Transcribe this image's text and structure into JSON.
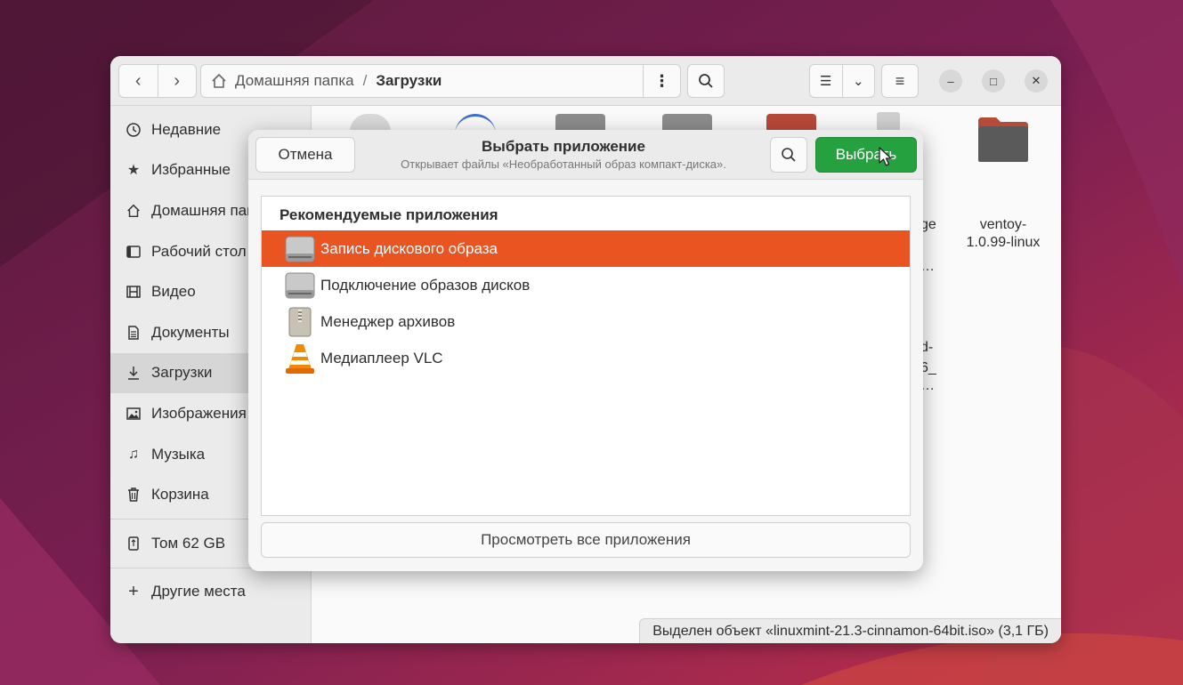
{
  "file_manager": {
    "path": {
      "home": "Домашняя папка",
      "separator": "/",
      "current": "Загрузки"
    },
    "sidebar": {
      "items": [
        {
          "label": "Недавние",
          "icon": "clock-icon"
        },
        {
          "label": "Избранные",
          "icon": "star-icon"
        },
        {
          "label": "Домашняя папка",
          "icon": "home-icon"
        },
        {
          "label": "Рабочий стол",
          "icon": "desktop-icon"
        },
        {
          "label": "Видео",
          "icon": "film-icon"
        },
        {
          "label": "Документы",
          "icon": "document-icon"
        },
        {
          "label": "Загрузки",
          "icon": "download-icon",
          "active": true
        },
        {
          "label": "Изображения",
          "icon": "image-icon"
        },
        {
          "label": "Музыка",
          "icon": "music-icon"
        },
        {
          "label": "Корзина",
          "icon": "trash-icon"
        }
      ],
      "devices": [
        {
          "label": "Том 62 GB",
          "icon": "usb-drive-icon"
        }
      ],
      "other": {
        "label": "Другие места",
        "icon": "plus-icon"
      }
    },
    "files": {
      "partial_label_1a": "ge",
      "partial_label_1b": "…",
      "partial_label_2a": "d-",
      "partial_label_2b": "6_",
      "partial_label_2c": "…",
      "folder_label_line1": "ventoy-",
      "folder_label_line2": "1.0.99-linux"
    },
    "status": "Выделен объект «linuxmint-21.3-cinnamon-64bit.iso» (3,1 ГБ)"
  },
  "dialog": {
    "cancel_label": "Отмена",
    "title": "Выбрать приложение",
    "subtitle": "Открывает файлы «Необработанный образ компакт-диска».",
    "select_label": "Выбрать",
    "list_heading": "Рекомендуемые приложения",
    "apps": [
      {
        "label": "Запись дискового образа",
        "icon": "disk-drive-icon",
        "selected": true
      },
      {
        "label": "Подключение образов дисков",
        "icon": "disk-drive-icon"
      },
      {
        "label": "Менеджер архивов",
        "icon": "archive-icon"
      },
      {
        "label": "Медиаплеер VLC",
        "icon": "vlc-cone-icon"
      }
    ],
    "view_all_label": "Просмотреть все приложения"
  },
  "colors": {
    "accent_orange": "#e95420",
    "select_green": "#26a140"
  }
}
